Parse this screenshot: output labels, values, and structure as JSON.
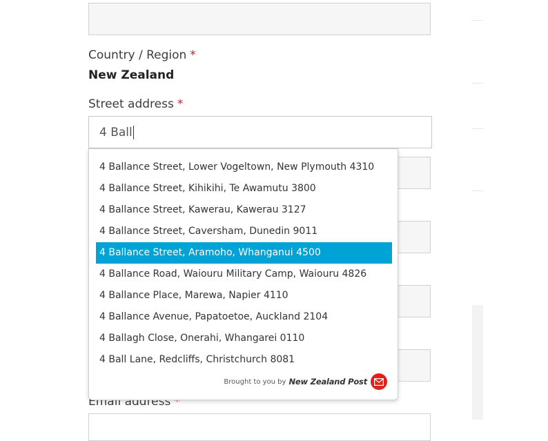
{
  "form": {
    "country_label": "Country / Region",
    "required_mark": "*",
    "country_value": "New Zealand",
    "street_label": "Street address",
    "street_value": "4 Ball",
    "email_label": "Email address"
  },
  "suggestions": [
    {
      "text": "4 Ballance Street, Lower Vogeltown, New Plymouth 4310"
    },
    {
      "text": "4 Ballance Street, Kihikihi, Te Awamutu 3800"
    },
    {
      "text": "4 Ballance Street, Kawerau, Kawerau 3127"
    },
    {
      "text": "4 Ballance Street, Caversham, Dunedin 9011"
    },
    {
      "text": "4 Ballance Street, Aramoho, Whanganui 4500"
    },
    {
      "text": "4 Ballance Road, Waiouru Military Camp, Waiouru 4826"
    },
    {
      "text": "4 Ballance Place, Marewa, Napier 4110"
    },
    {
      "text": "4 Ballance Avenue, Papatoetoe, Auckland 2104"
    },
    {
      "text": "4 Ballagh Close, Onerahi, Whangarei 0110"
    },
    {
      "text": "4 Ball Lane, Redcliffs, Christchurch 8081"
    }
  ],
  "highlighted_suggestion": "4 Ballance Street, Aramoho, Whanganui 4500",
  "attribution": {
    "prefix": "Brought to you by",
    "brand": "New Zealand Post",
    "logo_icon": "nzpost-envelope-icon"
  },
  "colors": {
    "highlight": "#00a3d6",
    "required": "#cc2222",
    "logo": "#e0201b"
  }
}
